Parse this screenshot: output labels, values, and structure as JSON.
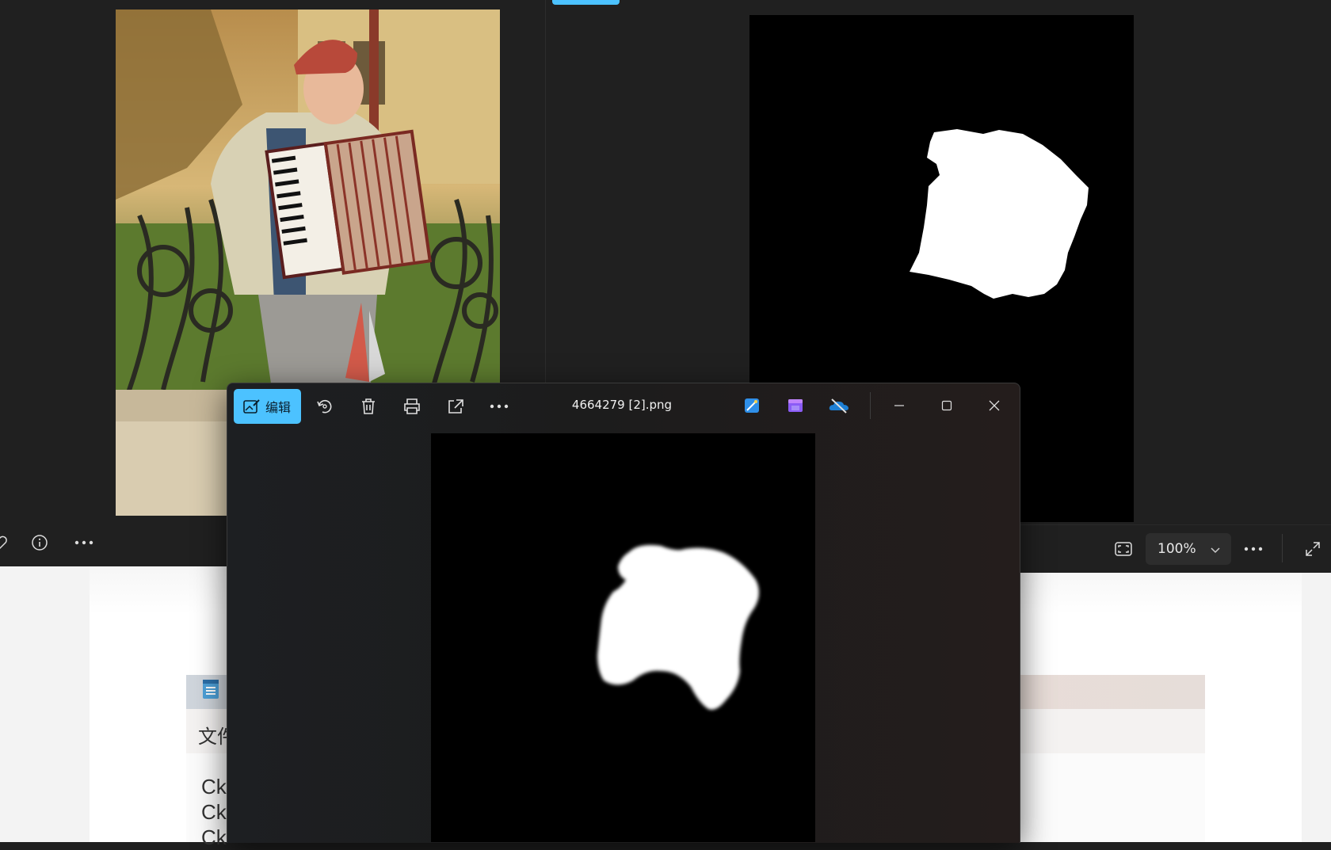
{
  "background_document": {
    "menu_first_item": "文件",
    "lines": [
      "Ck",
      "Ck",
      "Ck"
    ]
  },
  "left_viewer": {
    "toolbar": [
      "favorite-icon",
      "info-icon",
      "more-icon"
    ]
  },
  "right_viewer": {
    "zoom": "100%",
    "toolbar": [
      "fit-window-icon",
      "zoom-dropdown",
      "more-icon",
      "fullscreen-icon"
    ]
  },
  "front_window": {
    "title": "4664279 [2].png",
    "edit_label": "编辑",
    "toolbar": [
      "edit-image-icon",
      "rotate-icon",
      "delete-icon",
      "print-icon",
      "share-icon",
      "more-icon"
    ],
    "app_icons": [
      "photos-editor-icon",
      "clipchamp-icon",
      "onedrive-off-icon"
    ],
    "controls": [
      "minimize",
      "maximize",
      "close"
    ]
  },
  "colors": {
    "accent": "#4cc2ff",
    "dark_bg": "#202020",
    "mask_bg": "#000000",
    "mask_fg": "#ffffff"
  }
}
